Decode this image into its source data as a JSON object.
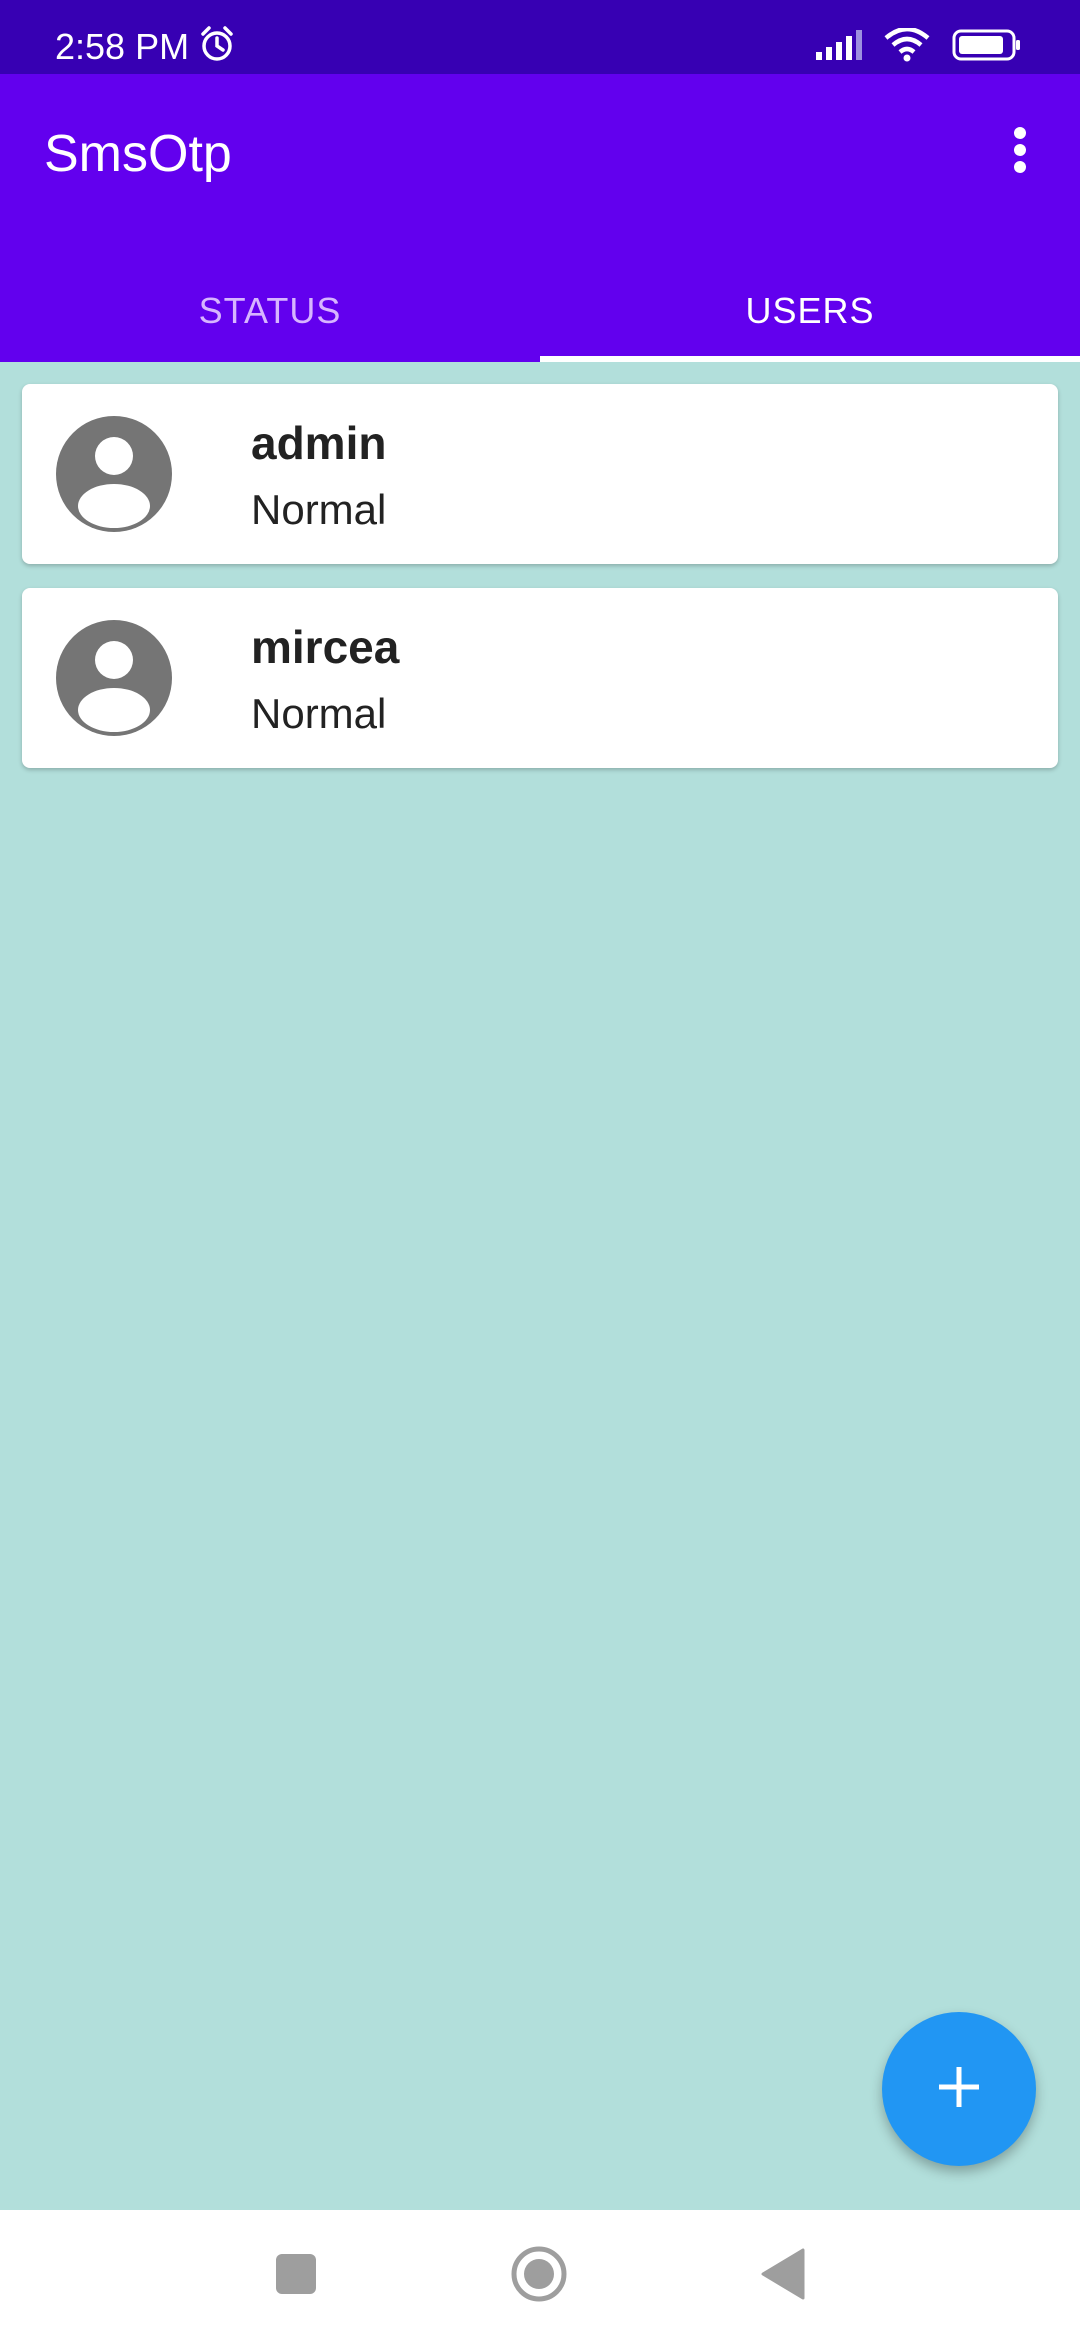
{
  "status_bar": {
    "time": "2:58 PM",
    "icons": [
      "alarm-icon",
      "signal-icon",
      "wifi-icon",
      "battery-icon"
    ]
  },
  "app_bar": {
    "title": "SmsOtp",
    "overflow_icon": "more-vert-icon"
  },
  "tabs": [
    {
      "label": "STATUS",
      "active": false
    },
    {
      "label": "USERS",
      "active": true
    }
  ],
  "users": [
    {
      "name": "admin",
      "role": "Normal",
      "icon": "account-circle-icon"
    },
    {
      "name": "mircea",
      "role": "Normal",
      "icon": "account-circle-icon"
    }
  ],
  "fab": {
    "icon": "plus-icon"
  },
  "nav_bar": {
    "buttons": [
      "recents-icon",
      "home-icon",
      "back-icon"
    ]
  },
  "colors": {
    "status_bar": "#3700b3",
    "primary": "#6200ee",
    "background": "#b2dfdb",
    "fab": "#2196f3"
  }
}
